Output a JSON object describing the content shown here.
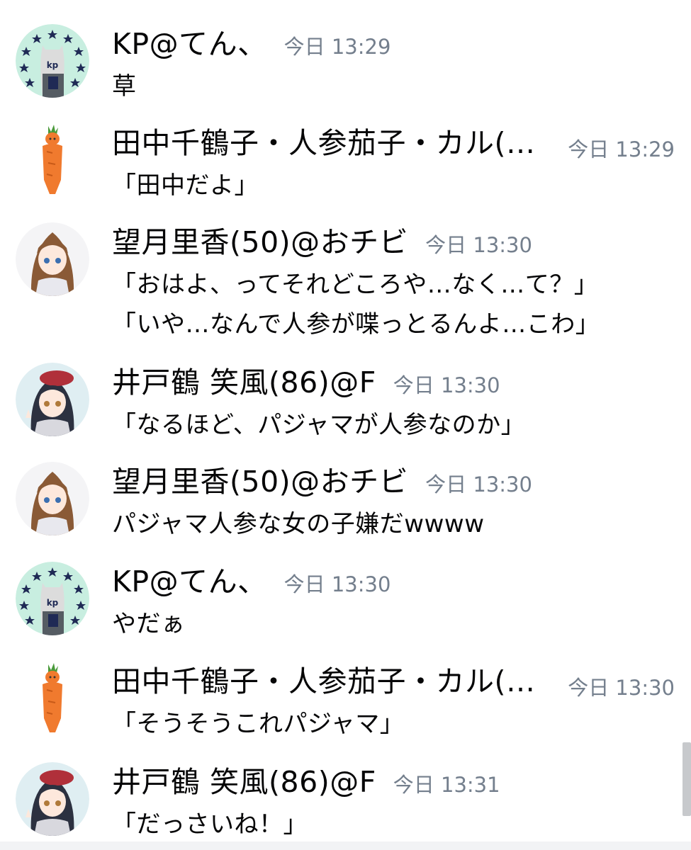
{
  "messages": [
    {
      "author": "KP@てん、",
      "time": "今日 13:29",
      "avatar": "kp-avatar",
      "lines": [
        "草"
      ]
    },
    {
      "author": "田中千鶴子・人参茄子・カル(…",
      "time": "今日 13:29",
      "avatar": "carrot-avatar",
      "lines": [
        "「田中だよ」"
      ]
    },
    {
      "author": "望月里香(50)@おチビ",
      "time": "今日 13:30",
      "avatar": "brown-hair-avatar",
      "lines": [
        "「おはよ、ってそれどころや…なく…て？」",
        "「いや…なんで人参が喋っとるんよ…こわ」"
      ]
    },
    {
      "author": "井戸鶴 笑風(86)@F",
      "time": "今日 13:30",
      "avatar": "beret-girl-avatar",
      "lines": [
        "「なるほど、パジャマが人参なのか」"
      ]
    },
    {
      "author": "望月里香(50)@おチビ",
      "time": "今日 13:30",
      "avatar": "brown-hair-avatar",
      "lines": [
        "パジャマ人参な女の子嫌だwwww"
      ]
    },
    {
      "author": "KP@てん、",
      "time": "今日 13:30",
      "avatar": "kp-avatar",
      "lines": [
        "やだぁ"
      ]
    },
    {
      "author": "田中千鶴子・人参茄子・カル(…",
      "time": "今日 13:30",
      "avatar": "carrot-avatar",
      "lines": [
        "「そうそうこれパジャマ」"
      ]
    },
    {
      "author": "井戸鶴 笑風(86)@F",
      "time": "今日 13:31",
      "avatar": "beret-girl-avatar",
      "lines": [
        "「だっさいね！」"
      ]
    }
  ],
  "colors": {
    "text": "#060607",
    "timestamp": "#747f8d",
    "kp_avatar_bg": "#c8eee0",
    "carrot": "#f07a2e"
  }
}
